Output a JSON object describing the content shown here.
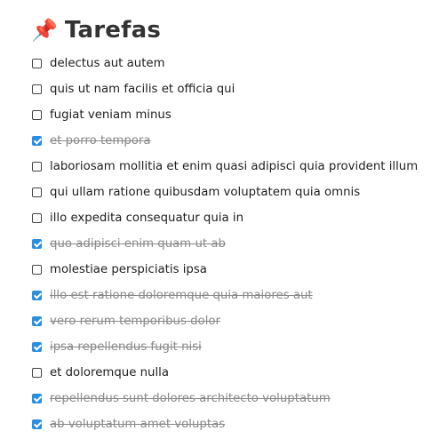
{
  "header": {
    "icon": "pushpin-icon",
    "icon_glyph": "📌",
    "title": "Tarefas"
  },
  "todos": [
    {
      "label": "delectus aut autem",
      "done": false
    },
    {
      "label": "quis ut nam facilis et officia qui",
      "done": false
    },
    {
      "label": "fugiat veniam minus",
      "done": false
    },
    {
      "label": "et porro tempora",
      "done": true
    },
    {
      "label": "laboriosam mollitia et enim quasi adipisci quia provident illum",
      "done": false
    },
    {
      "label": "qui ullam ratione quibusdam voluptatem quia omnis",
      "done": false
    },
    {
      "label": "illo expedita consequatur quia in",
      "done": false
    },
    {
      "label": "quo adipisci enim quam ut ab",
      "done": true
    },
    {
      "label": "molestiae perspiciatis ipsa",
      "done": false
    },
    {
      "label": "illo est ratione doloremque quia maiores aut",
      "done": true
    },
    {
      "label": "vero rerum temporibus dolor",
      "done": true
    },
    {
      "label": "ipsa repellendus fugit nisi",
      "done": true
    },
    {
      "label": "et doloremque nulla",
      "done": false
    },
    {
      "label": "repellendus sunt dolores architecto voluptatum",
      "done": true
    },
    {
      "label": "ab voluptatum amet voluptas",
      "done": true
    }
  ],
  "colors": {
    "checkbox_checked": "#2a8fe0",
    "done_text": "#8a8a8a",
    "title_text": "#333333"
  }
}
